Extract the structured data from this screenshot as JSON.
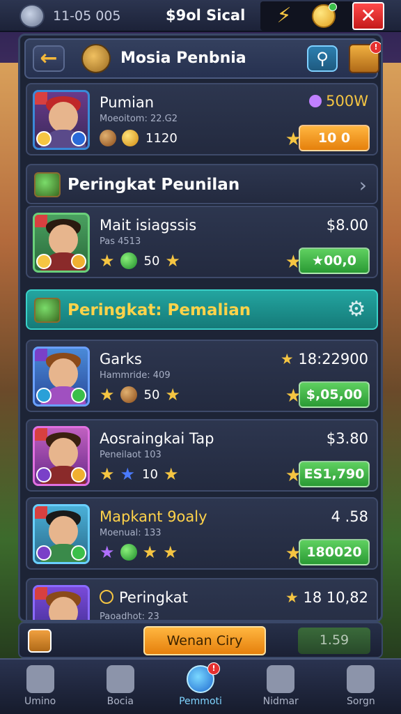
{
  "topbar": {
    "date": "11-05 005",
    "title": "$9ol Sical",
    "close_symbol": "✕",
    "bolt_symbol": "⚡",
    "coin_badge": "!"
  },
  "header": {
    "back_symbol": "←",
    "title": "Mosia Penbnia",
    "search_symbol": "⚲",
    "chest_badge": "!"
  },
  "cards": [
    {
      "name": "Pumian",
      "sub": "Moeoitom: 22.G2",
      "resources": [
        {
          "icon": "brown"
        },
        {
          "icon": "gold"
        }
      ],
      "count": "1120",
      "price": "500W",
      "button": "10 0",
      "button_style": "orange"
    },
    {
      "name": "Mait isiagssis",
      "sub": "Pas 4513",
      "resources": [
        {
          "icon": "star"
        },
        {
          "icon": "green"
        }
      ],
      "count": "50",
      "price": "$8.00",
      "button": "★00,0",
      "button_style": "green"
    },
    {
      "name": "Garks",
      "sub": "Hammride: 409",
      "resources": [
        {
          "icon": "star"
        },
        {
          "icon": "brown"
        }
      ],
      "count": "50",
      "price": "18:22900",
      "button": "$,05,00",
      "button_style": "green"
    },
    {
      "name": "Aosraingkai Tap",
      "sub": "Peneilaot 103",
      "resources": [
        {
          "icon": "star"
        },
        {
          "icon": "blue"
        }
      ],
      "count": "10",
      "price": "$3.80",
      "button": "ES1,790",
      "button_style": "green"
    },
    {
      "name": "Mapkant 9oaly",
      "sub": "Moenual: 133",
      "resources": [
        {
          "icon": "purple"
        },
        {
          "icon": "green"
        }
      ],
      "count": "",
      "price": "4 .58",
      "button": "180020",
      "button_style": "green"
    },
    {
      "name": "Peringkat",
      "sub": "Paoadhot: 23",
      "resources": [],
      "count": "",
      "price": "18 10,82",
      "button": "",
      "button_style": "none"
    }
  ],
  "sections": [
    {
      "title": "Peringkat Peunilan",
      "style": "dark",
      "action": "›"
    },
    {
      "title": "Peringkat: Pemalian",
      "style": "teal",
      "action": "⚙"
    }
  ],
  "strip": {
    "main_button": "Wenan Ciry",
    "dim_button": "1.59"
  },
  "nav": [
    {
      "label": "Umino"
    },
    {
      "label": "Bocia"
    },
    {
      "label": "Pemmoti",
      "badge": "!"
    },
    {
      "label": "Nidmar"
    },
    {
      "label": "Sorgn"
    }
  ]
}
